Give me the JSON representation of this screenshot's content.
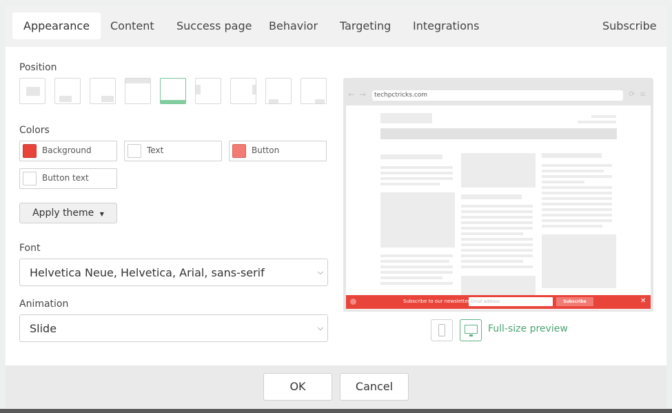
{
  "tabs": [
    {
      "label": "Appearance",
      "active": true
    },
    {
      "label": "Content"
    },
    {
      "label": "Success page"
    },
    {
      "label": "Behavior"
    },
    {
      "label": "Targeting"
    },
    {
      "label": "Integrations"
    }
  ],
  "subscribe_tab": "Subscribe",
  "position": {
    "label": "Position",
    "options": [
      "center-modal",
      "bottom-center",
      "bottom-right",
      "top-bar",
      "bottom-bar",
      "left-side",
      "right-side",
      "bottom-left-small",
      "bottom-right-small"
    ],
    "selected": "bottom-bar"
  },
  "colors": {
    "label": "Colors",
    "items": [
      {
        "label": "Background",
        "color": "#e8443a"
      },
      {
        "label": "Text",
        "color": "#ffffff"
      },
      {
        "label": "Button",
        "color": "#f27c73"
      },
      {
        "label": "Button text",
        "color": "#ffffff"
      }
    ]
  },
  "apply_theme": "Apply theme",
  "font": {
    "label": "Font",
    "value": "Helvetica Neue, Helvetica, Arial, sans-serif"
  },
  "animation": {
    "label": "Animation",
    "value": "Slide"
  },
  "preview": {
    "url": "techpctricks.com",
    "bar_text": "Subscribe to our newsletter",
    "email_placeholder": "Email address",
    "button": "Subscribe",
    "close": "✕",
    "accent": "#e8443a",
    "button_color": "#f27c73"
  },
  "devices": {
    "mobile_icon": "mobile-icon",
    "desktop_icon": "desktop-icon",
    "selected": "desktop",
    "full_size_label": "Full-size preview",
    "link_color": "#4aa371"
  },
  "footer": {
    "ok": "OK",
    "cancel": "Cancel"
  }
}
